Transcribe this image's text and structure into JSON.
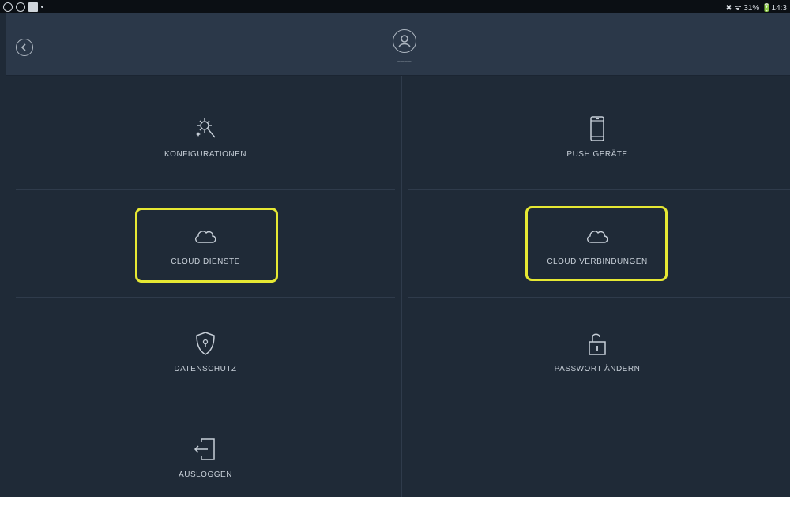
{
  "statusbar": {
    "right_text": "✖ ᯤ 31% 🔋14:3"
  },
  "header": {
    "username": "~~~~"
  },
  "menu": [
    {
      "label": "KONFIGURATIONEN",
      "icon": "wand-gear-icon"
    },
    {
      "label": "PUSH GERÄTE",
      "icon": "smartphone-icon"
    },
    {
      "label": "CLOUD DIENSTE",
      "icon": "cloud-icon"
    },
    {
      "label": "CLOUD VERBINDUNGEN",
      "icon": "cloud-icon"
    },
    {
      "label": "DATENSCHUTZ",
      "icon": "shield-lock-icon"
    },
    {
      "label": "PASSWORT ÄNDERN",
      "icon": "unlock-icon"
    },
    {
      "label": "AUSLOGGEN",
      "icon": "logout-icon"
    }
  ],
  "colors": {
    "background": "#1f2a37",
    "header": "#2b3849",
    "highlight": "#e6e833",
    "text": "#c7cfd8"
  }
}
